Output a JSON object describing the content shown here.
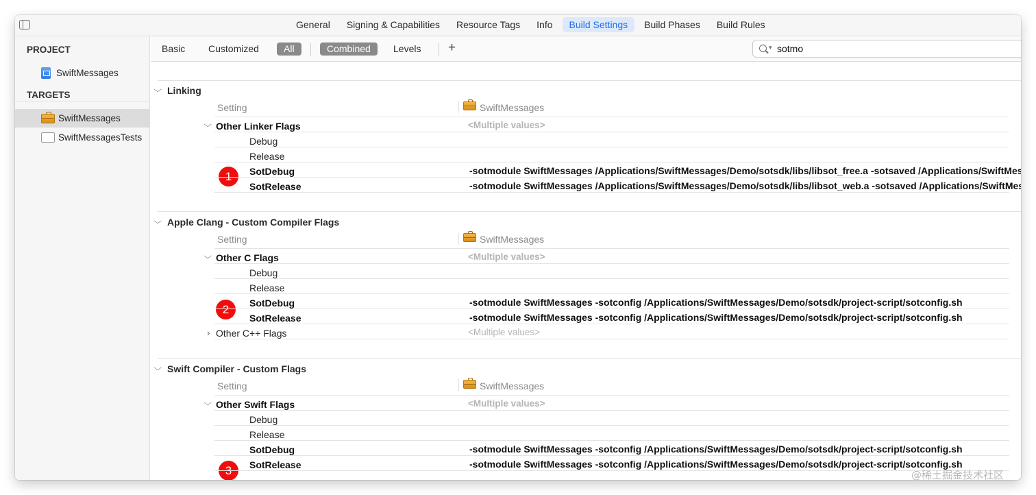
{
  "tabs": [
    "General",
    "Signing & Capabilities",
    "Resource Tags",
    "Info",
    "Build Settings",
    "Build Phases",
    "Build Rules"
  ],
  "active_tab": "Build Settings",
  "sidebar": {
    "project_header": "PROJECT",
    "project_item": "SwiftMessages",
    "targets_header": "TARGETS",
    "targets": [
      "SwiftMessages",
      "SwiftMessagesTests"
    ],
    "selected_target": "SwiftMessages"
  },
  "filter": {
    "basic": "Basic",
    "customized": "Customized",
    "all": "All",
    "combined": "Combined",
    "levels": "Levels",
    "add": "+"
  },
  "search": {
    "value": "sotmo"
  },
  "sections": [
    {
      "title": "Linking",
      "setting_label": "Setting",
      "column_target": "SwiftMessages",
      "group": "Other Linker Flags",
      "group_value": "<Multiple values>",
      "debug": "Debug",
      "release": "Release",
      "sotdebug": "SotDebug",
      "sotdebug_value": "-sotmodule SwiftMessages /Applications/SwiftMessages/Demo/sotsdk/libs/libsot_free.a -sotsaved /Applications/SwiftMessages/Demo/sotsdk/sotsaved",
      "sotrelease": "SotRelease",
      "sotrelease_value": "-sotmodule SwiftMessages /Applications/SwiftMessages/Demo/sotsdk/libs/libsot_web.a -sotsaved /Applications/SwiftMessages/Demo/sotsdk/sotsaved",
      "badge": "1"
    },
    {
      "title": "Apple Clang - Custom Compiler Flags",
      "setting_label": "Setting",
      "column_target": "SwiftMessages",
      "group": "Other C Flags",
      "group_value": "<Multiple values>",
      "debug": "Debug",
      "release": "Release",
      "sotdebug": "SotDebug",
      "sotdebug_value": "-sotmodule SwiftMessages -sotconfig /Applications/SwiftMessages/Demo/sotsdk/project-script/sotconfig.sh",
      "sotrelease": "SotRelease",
      "sotrelease_value": "-sotmodule SwiftMessages -sotconfig /Applications/SwiftMessages/Demo/sotsdk/project-script/sotconfig.sh",
      "extra_group": "Other C++ Flags",
      "extra_value": "<Multiple values>",
      "badge": "2"
    },
    {
      "title": "Swift Compiler - Custom Flags",
      "setting_label": "Setting",
      "column_target": "SwiftMessages",
      "group": "Other Swift Flags",
      "group_value": "<Multiple values>",
      "debug": "Debug",
      "release": "Release",
      "sotdebug": "SotDebug",
      "sotdebug_value": "-sotmodule SwiftMessages -sotconfig /Applications/SwiftMessages/Demo/sotsdk/project-script/sotconfig.sh",
      "sotrelease": "SotRelease",
      "sotrelease_value": "-sotmodule SwiftMessages -sotconfig /Applications/SwiftMessages/Demo/sotsdk/project-script/sotconfig.sh",
      "badge": "3"
    }
  ],
  "watermark": "@稀土掘金技术社区",
  "colors": {
    "accent": "#1f6fe5",
    "badge": "#f20d0d",
    "pill": "#8a8a8a"
  }
}
